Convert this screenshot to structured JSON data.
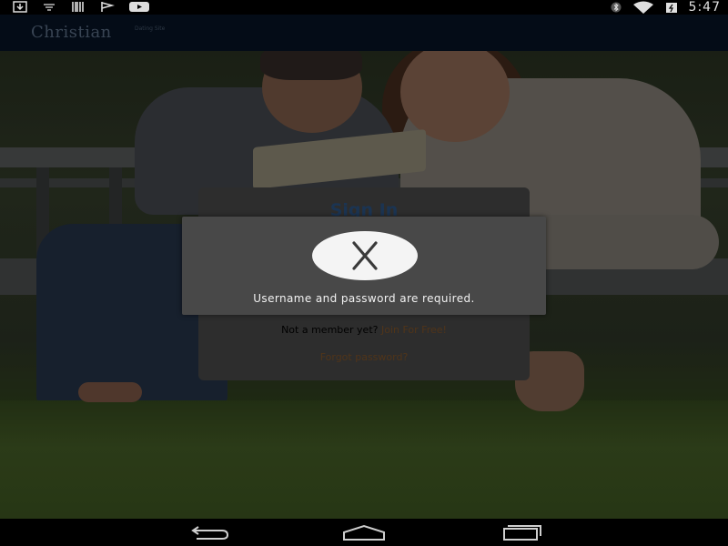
{
  "status_bar": {
    "time": "5:47",
    "left_icons": [
      "download-icon",
      "signal-bars-icon",
      "barcode-icon",
      "flag-icon",
      "youtube-icon"
    ],
    "right_icons": [
      "bluetooth-icon",
      "wifi-icon",
      "battery-icon"
    ]
  },
  "header": {
    "logo_text": "Christian",
    "logo_small": "Dating Site"
  },
  "signin": {
    "title": "Sign In",
    "not_member": "Not a member yet?",
    "join_link": "Join For Free!",
    "forgot_link": "Forgot password?"
  },
  "dialog": {
    "icon": "close-icon",
    "message": "Username and password are required."
  },
  "nav": {
    "items": [
      "back-icon",
      "home-icon",
      "recent-apps-icon"
    ]
  }
}
